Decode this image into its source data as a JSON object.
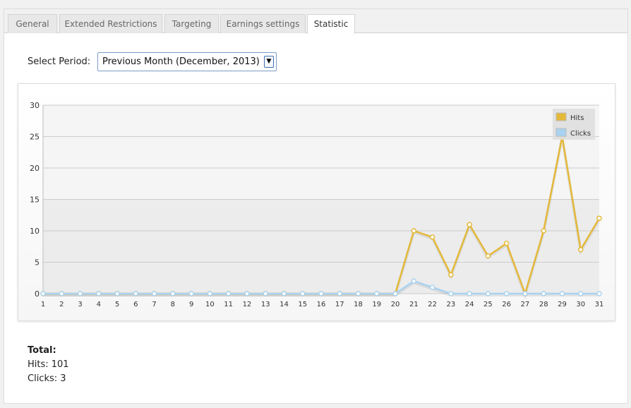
{
  "tabs": [
    {
      "label": "General",
      "active": false
    },
    {
      "label": "Extended Restrictions",
      "active": false
    },
    {
      "label": "Targeting",
      "active": false
    },
    {
      "label": "Earnings settings",
      "active": false
    },
    {
      "label": "Statistic",
      "active": true
    }
  ],
  "period": {
    "label": "Select Period:",
    "selected": "Previous Month (December, 2013)"
  },
  "colors": {
    "hits": "#e4b93a",
    "clicks": "#a9d2f0",
    "grid": "#cccccc"
  },
  "chart_data": {
    "type": "line",
    "x": [
      1,
      2,
      3,
      4,
      5,
      6,
      7,
      8,
      9,
      10,
      11,
      12,
      13,
      14,
      15,
      16,
      17,
      18,
      19,
      20,
      21,
      22,
      23,
      24,
      25,
      26,
      27,
      28,
      29,
      30,
      31
    ],
    "ylim": [
      0,
      30
    ],
    "yticks": [
      0,
      5,
      10,
      15,
      20,
      25,
      30
    ],
    "grid": true,
    "legend_position": "top-right",
    "series": [
      {
        "name": "Hits",
        "color": "#e4b93a",
        "values": [
          0,
          0,
          0,
          0,
          0,
          0,
          0,
          0,
          0,
          0,
          0,
          0,
          0,
          0,
          0,
          0,
          0,
          0,
          0,
          0,
          10,
          9,
          3,
          11,
          6,
          8,
          0,
          10,
          25,
          7,
          12
        ]
      },
      {
        "name": "Clicks",
        "color": "#a9d2f0",
        "values": [
          0,
          0,
          0,
          0,
          0,
          0,
          0,
          0,
          0,
          0,
          0,
          0,
          0,
          0,
          0,
          0,
          0,
          0,
          0,
          0,
          2,
          1,
          0,
          0,
          0,
          0,
          0,
          0,
          0,
          0,
          0
        ]
      }
    ]
  },
  "totals": {
    "heading": "Total:",
    "hits": "Hits: 101",
    "clicks": "Clicks: 3"
  }
}
